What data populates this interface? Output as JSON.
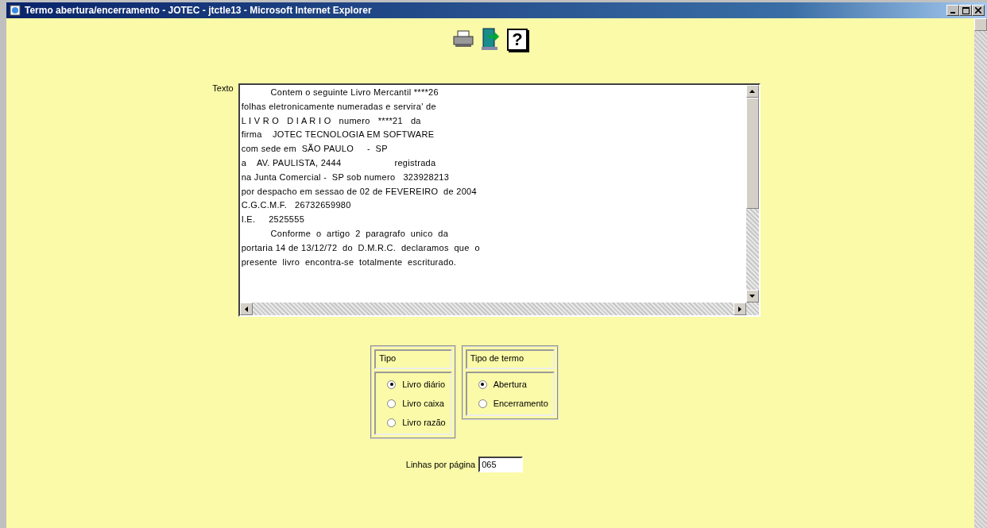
{
  "window": {
    "title": "Termo abertura/encerramento - JOTEC - jtctle13 - Microsoft Internet Explorer"
  },
  "toolbar": {
    "help": "?"
  },
  "texto": {
    "label": "Texto",
    "lines": [
      {
        "text": "           Contem o seguinte Livro Mercantil ****26"
      },
      {
        "text": "folhas eletronicamente numeradas e servira' de"
      },
      {
        "text": "L I V R O   D I A R I O   numero   ****21   da"
      },
      {
        "text": "firma    JOTEC TECNOLOGIA EM SOFTWARE"
      },
      {
        "text": "com sede em  SÃO PAULO     -  SP"
      },
      {
        "text": "a    AV. PAULISTA, 2444                    registrada"
      },
      {
        "text": "na Junta Comercial -  SP sob numero   323928213"
      },
      {
        "text": "por despacho em sessao de 02 de FEVEREIRO  de 2004"
      },
      {
        "text": "C.G.C.M.F.   26732659980"
      },
      {
        "text": "I.E.     2525555"
      },
      {
        "text": "           Conforme  o  artigo  2  paragrafo  unico  da"
      },
      {
        "text": "portaria 14 de 13/12/72  do  D.M.R.C.  declaramos  que  o"
      },
      {
        "text": "presente  livro  encontra-se  totalmente  escriturado."
      }
    ]
  },
  "groups": [
    {
      "legend": "Tipo",
      "options": [
        {
          "label": "Livro diário",
          "selected": true
        },
        {
          "label": "Livro caixa",
          "selected": false
        },
        {
          "label": "Livro razão",
          "selected": false
        }
      ]
    },
    {
      "legend": "Tipo de termo",
      "options": [
        {
          "label": "Abertura",
          "selected": true
        },
        {
          "label": "Encerramento",
          "selected": false
        }
      ]
    }
  ],
  "linhas": {
    "label": "Linhas por página",
    "value": "065"
  }
}
